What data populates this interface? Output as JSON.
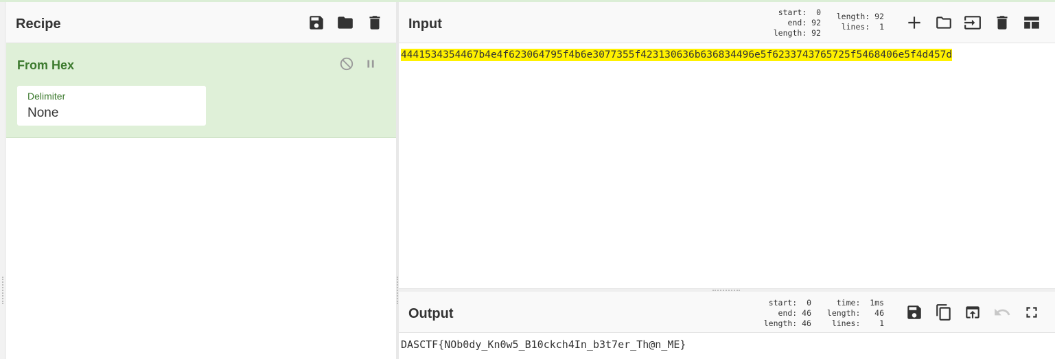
{
  "recipe": {
    "title": "Recipe",
    "buttons": [
      "save-icon",
      "folder-icon",
      "trash-icon"
    ],
    "operation": {
      "name": "From Hex",
      "disable_icon": "disable-icon",
      "pause_icon": "pause-icon",
      "arg_label": "Delimiter",
      "arg_value": "None"
    }
  },
  "input": {
    "title": "Input",
    "stats_left": "start:  0\nend: 92\nlength: 92",
    "stats_right": "length: 92\nlines:  1",
    "text": "4441534354467b4e4f623064795f4b6e3077355f423130636b636834496e5f6233743765725f5468406e5f4d457d",
    "highlight_color": "#fff100",
    "buttons": [
      "plus-icon",
      "folder-icon",
      "insert-icon",
      "trash-icon",
      "layout-icon"
    ]
  },
  "output": {
    "title": "Output",
    "stats_left": "start:  0\nend: 46\nlength: 46",
    "stats_right": "time:  1ms\nlength:   46\nlines:    1",
    "text": "DASCTF{NOb0dy_Kn0w5_B10ckch4In_b3t7er_Th@n_ME}",
    "buttons": [
      "save-icon",
      "copy-icon",
      "replace-input-icon",
      "undo-icon",
      "maximize-icon"
    ]
  },
  "colors": {
    "op_bg": "#dff0d8",
    "op_text": "#3c7a2e"
  }
}
